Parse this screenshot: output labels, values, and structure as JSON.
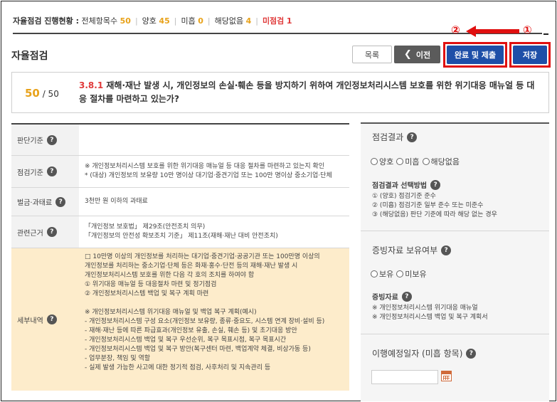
{
  "status": {
    "label": "자율점검 진행현황 :",
    "total_label": "전체항목수",
    "total_value": "50",
    "good_label": "양호",
    "good_value": "45",
    "insufficient_label": "미흡",
    "insufficient_value": "0",
    "na_label": "해당없음",
    "na_value": "4",
    "unchecked_label": "미점검",
    "unchecked_value": "1"
  },
  "annotation": {
    "step2": "②",
    "step1": "①"
  },
  "header": {
    "title": "자율점검",
    "list_button": "목록",
    "prev_icon": "chevron-left-icon",
    "prev_button": "이전",
    "complete_button": "완료 및 제출",
    "save_button": "저장"
  },
  "question": {
    "current": "50",
    "total": "/ 50",
    "code": "3.8.1",
    "text": "재해·재난 발생 시, 개인정보의 손실·훼손 등을 방지하기 위하여 개인정보처리시스템 보호를 위한 위기대응 매뉴얼 등 대응 절차를 마련하고 있는가?"
  },
  "table": {
    "judgment_label": "판단기준",
    "judgment_value": "",
    "check_label": "점검기준",
    "check_lines": [
      "※ 개인정보처리시스템 보호를 위한 위기대응 매뉴얼 등 대응 절차를 마련하고 있는지 확인",
      "* (대상) 개인정보의 보유량 10만 명이상 대기업·중견기업 또는 100만 명이상 중소기업·단체"
    ],
    "penalty_label": "벌금·과태료",
    "penalty_value": "3천만 원 이하의 과태료",
    "basis_label": "관련근거",
    "basis_lines": [
      "「개인정보 보호법」 제29조(안전조치 의무)",
      "「개인정보의 안전성 확보조치 기준」 제11조(재해·재난 대비 안전조치)"
    ],
    "detail_label": "세부내역",
    "detail_lines": [
      "□ 10만명 이상의 개인정보를 처리하는 대기업·중견기업·공공기관 또는 100만명 이상의",
      "개인정보를 처리하는 중소기업·단체 등은 화재·홍수·단전 등의 재해·재난 발생 시",
      "개인정보처리시스템 보호를 위한 다음 각 호의 조치를 하여야 함",
      "① 위기대응 매뉴얼 등 대응절차 마련 및 정기점검",
      "② 개인정보처리시스템 백업 및 복구 계획 마련",
      "",
      "※ 개인정보처리시스템 위기대응 매뉴얼 및 백업 복구 계획(예시)",
      "- 개인정보처리시스템 구성 요소(개인정보 보유량, 종류·중요도, 시스템 연계 장비·설비 등)",
      "- 재해·재난 등에 따른 파급효과(개인정보 유출, 손실, 훼손 등) 및 초기대응 방안",
      "- 개인정보처리시스템 백업 및 복구 우선순위, 복구 목표시점, 복구 목표시간",
      "- 개인정보처리시스템 백업 및 복구 방안(복구센터 마련, 백업계약 체결, 비상가동 등)",
      "- 업무분장, 책임 및 역할",
      "- 실제 발생 가능한 사고에 대한 정기적 점검, 사후처리 및 지속관리 등"
    ]
  },
  "panel": {
    "result_title": "점검결과",
    "result_options": [
      "양호",
      "미흡",
      "해당없음"
    ],
    "method_title": "점검결과 선택방법",
    "method_lines": [
      "① (양호) 점검기준 준수",
      "② (미흡) 점검기준 일부 준수 또는 미준수",
      "③ (해당없음) 판단 기준에 따라 해당 없는 경우"
    ],
    "evidence_title": "증빙자료 보유여부",
    "evidence_options": [
      "보유",
      "미보유"
    ],
    "evidence_docs_title": "증빙자료",
    "evidence_docs": [
      "※ 개인정보처리시스템 위기대응 매뉴얼",
      "※ 개인정보처리시스템 백업 및 복구 계획서"
    ],
    "schedule_title": "이행예정일자 (미흡 항목)",
    "schedule_value": ""
  },
  "colors": {
    "accent_blue": "#1e4fa8",
    "highlight_red": "#e01010",
    "orange": "#e8a21a",
    "detail_bg": "#fdeccb"
  }
}
